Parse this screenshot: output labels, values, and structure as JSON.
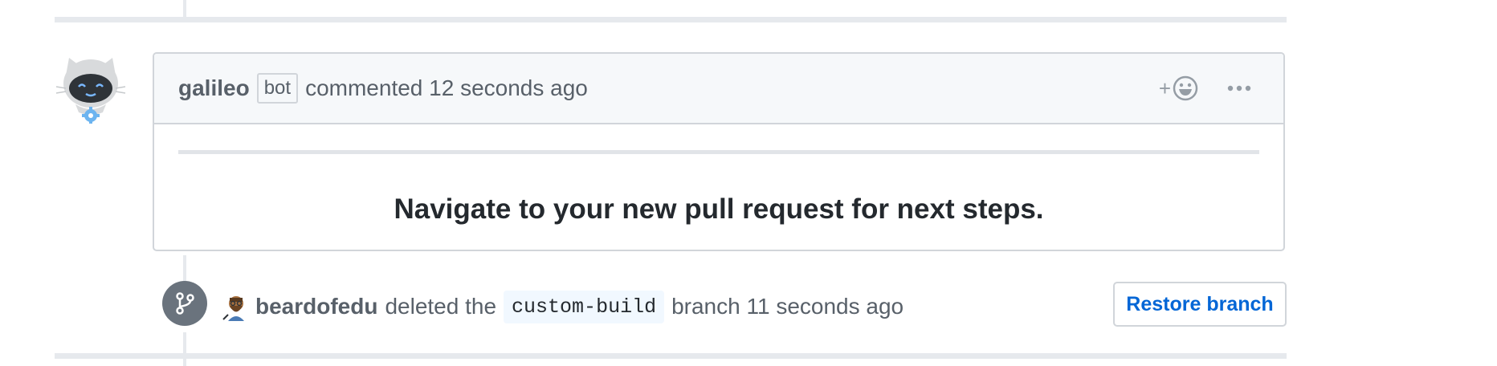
{
  "comment": {
    "author": "galileo",
    "author_badge": "bot",
    "action": "commented",
    "timestamp": "12 seconds ago",
    "add_reaction_symbol": "+",
    "add_reaction_icon": "smiley-icon",
    "more_icon": "kebab-horizontal-icon",
    "body": "Navigate to your new pull request for next steps."
  },
  "event": {
    "icon": "git-branch-icon",
    "actor": "beardofedu",
    "action": "deleted the",
    "branch": "custom-build",
    "suffix": "branch",
    "timestamp": "11 seconds ago",
    "restore_label": "Restore branch"
  },
  "colors": {
    "link_blue": "#0366d6",
    "muted_text": "#586069",
    "border": "#d1d5da",
    "header_bg": "#f6f8fa",
    "badge_gray": "#6a737d",
    "code_bg": "#f1f8ff"
  }
}
